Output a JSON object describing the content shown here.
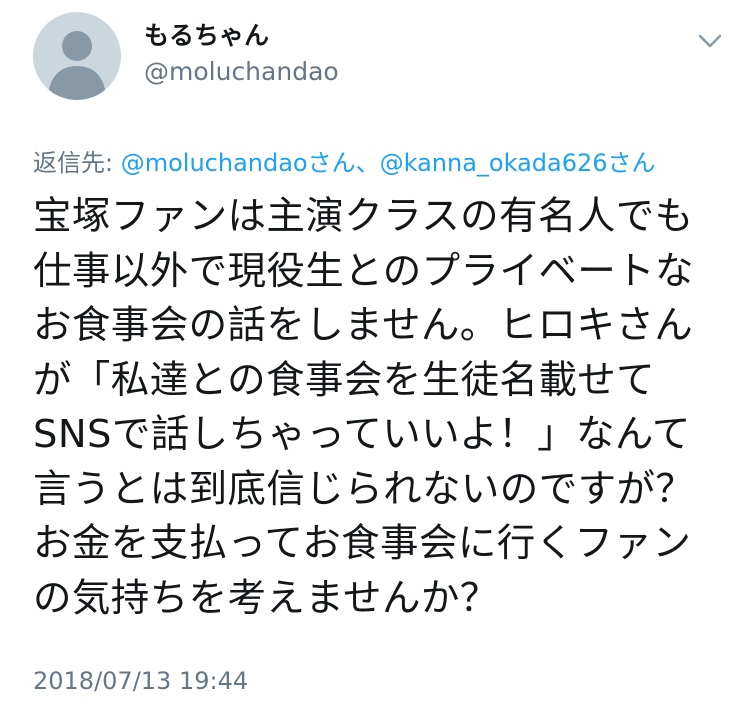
{
  "user": {
    "display_name": "もるちゃん",
    "handle": "@moluchandao",
    "avatar_icon": "default-profile-icon"
  },
  "reply": {
    "prefix": "返信先: ",
    "mention1": "@moluchandao",
    "suffix1": "さん、",
    "mention2": "@kanna_okada626",
    "suffix2": "さん"
  },
  "tweet": {
    "lines": [
      "宝塚ファンは主演クラスの有名人でも",
      "仕事以外で現役生とのプライベートな",
      "お食事会の話をしません。ヒロキさん",
      "が「私達との食事会を生徒名載せて",
      "SNSで話しちゃっていいよ！」なんて",
      "言うとは到底信じられないのですが？",
      "お金を支払ってお食事会に行くファン",
      "の気持ちを考えませんか？"
    ]
  },
  "timestamp": "2018/07/13 19:44",
  "colors": {
    "text": "#14171a",
    "secondary": "#657786",
    "link": "#1da1f2",
    "avatar_bg": "#ccd6dd",
    "avatar_fg": "#8899a6"
  }
}
